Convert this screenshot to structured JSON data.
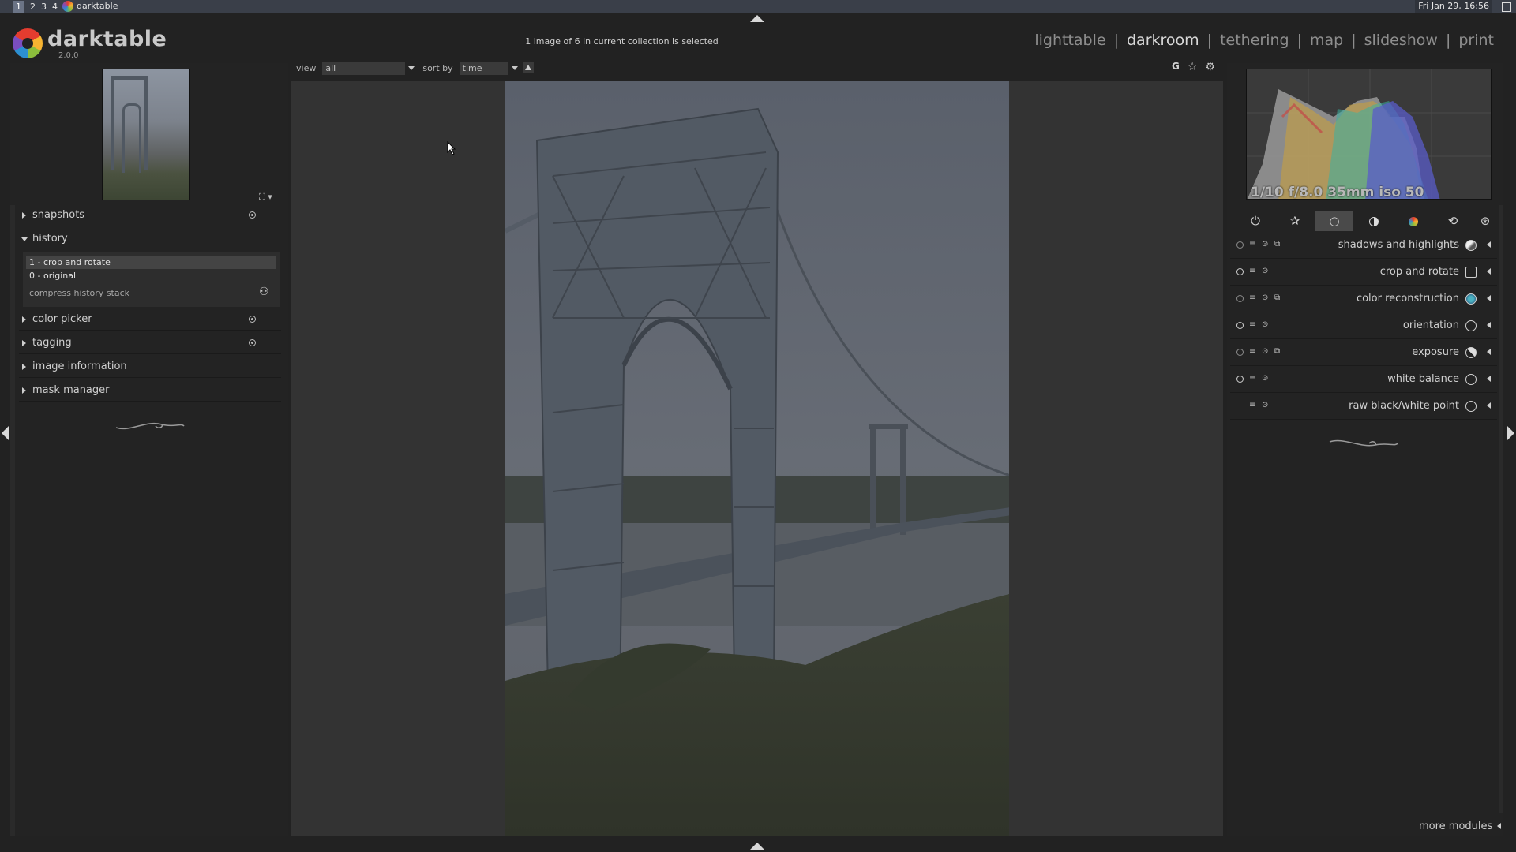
{
  "taskbar": {
    "workspaces": [
      "1",
      "2",
      "3",
      "4"
    ],
    "app_title": "darktable",
    "clock": "Fri Jan 29, 16:56"
  },
  "header": {
    "app_name": "darktable",
    "version": "2.0.0",
    "collection_info": "1 image of 6 in current collection is selected",
    "views": [
      "lighttable",
      "darkroom",
      "tethering",
      "map",
      "slideshow",
      "print"
    ],
    "active_view": "darkroom",
    "separator": "|"
  },
  "filterbar": {
    "view_label": "view",
    "view_value": "all",
    "sort_label": "sort by",
    "sort_value": "time"
  },
  "top_icons": {
    "grouping": "G",
    "star_icon": "☆",
    "gear_icon": "⚙"
  },
  "left_panel": {
    "modules": [
      {
        "name": "snapshots",
        "expanded": false
      },
      {
        "name": "history",
        "expanded": true
      },
      {
        "name": "color picker",
        "expanded": false
      },
      {
        "name": "tagging",
        "expanded": false
      },
      {
        "name": "image information",
        "expanded": false
      },
      {
        "name": "mask manager",
        "expanded": false
      }
    ],
    "history": {
      "items": [
        "1 - crop and rotate",
        "0 - original"
      ],
      "compress_label": "compress history stack"
    }
  },
  "right_panel": {
    "exif": "1/10 f/8.0 35mm iso 50",
    "group_tabs": [
      "power-icon",
      "star-icon",
      "circle-icon",
      "tone-icon",
      "color-icon",
      "correct-icon",
      "effect-icon"
    ],
    "modules": [
      {
        "label": "shadows and highlights",
        "enabled": false
      },
      {
        "label": "crop and rotate",
        "enabled": true
      },
      {
        "label": "color reconstruction",
        "enabled": false
      },
      {
        "label": "orientation",
        "enabled": true
      },
      {
        "label": "exposure",
        "enabled": false
      },
      {
        "label": "white balance",
        "enabled": true
      },
      {
        "label": "raw black/white point",
        "enabled": null
      }
    ],
    "more_modules": "more modules"
  },
  "colors": {
    "background": "#222222",
    "center": "#333333",
    "active_tab": "#4a4a4a"
  }
}
